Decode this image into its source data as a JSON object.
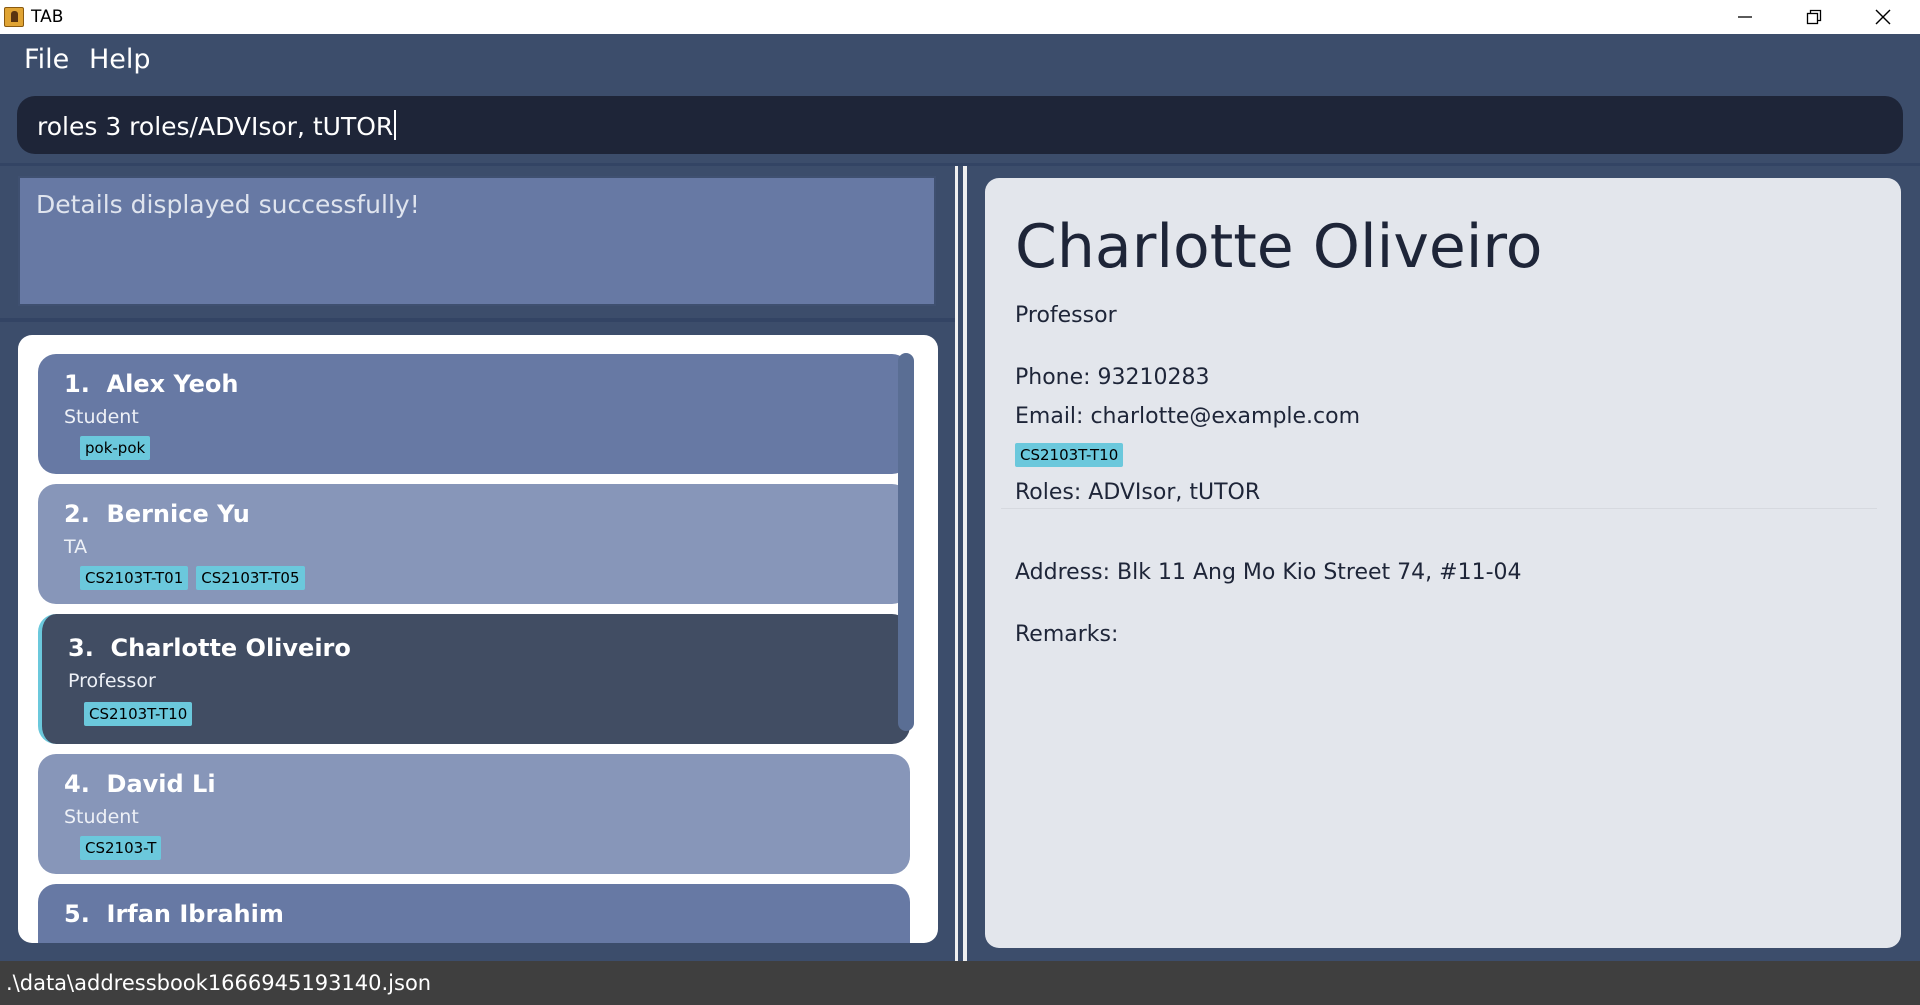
{
  "window": {
    "title": "TAB"
  },
  "menu": {
    "file": "File",
    "help": "Help"
  },
  "command": {
    "value": "roles 3 roles/ADVIsor, tUTOR"
  },
  "result": {
    "message": "Details displayed successfully!"
  },
  "persons": [
    {
      "name": "1.  Alex Yeoh",
      "role": "Student",
      "tags": [
        "pok-pok"
      ]
    },
    {
      "name": "2.  Bernice Yu",
      "role": "TA",
      "tags": [
        "CS2103T-T01",
        "CS2103T-T05"
      ]
    },
    {
      "name": "3.  Charlotte Oliveiro",
      "role": "Professor",
      "tags": [
        "CS2103T-T10"
      ]
    },
    {
      "name": "4.  David Li",
      "role": "Student",
      "tags": [
        "CS2103-T"
      ]
    },
    {
      "name": "5.  Irfan Ibrahim",
      "role": "",
      "tags": []
    }
  ],
  "detail": {
    "name": "Charlotte Oliveiro",
    "role": "Professor",
    "phone": "Phone: 93210283",
    "email": "Email: charlotte@example.com",
    "tag": "CS2103T-T10",
    "roles": "Roles: ADVIsor, tUTOR",
    "address": "Address: Blk 11 Ang Mo Kio Street 74, #11-04",
    "remarks": "Remarks:"
  },
  "status": {
    "path": ".\\data\\addressbook1666945193140.json"
  },
  "colors": {
    "background": "#3c4d6b",
    "card_default": "#6779a4",
    "card_alt": "#8796b9",
    "card_selected": "#414d63",
    "selected_accent": "#6bc8dc",
    "tag": "#6bc8dc"
  }
}
